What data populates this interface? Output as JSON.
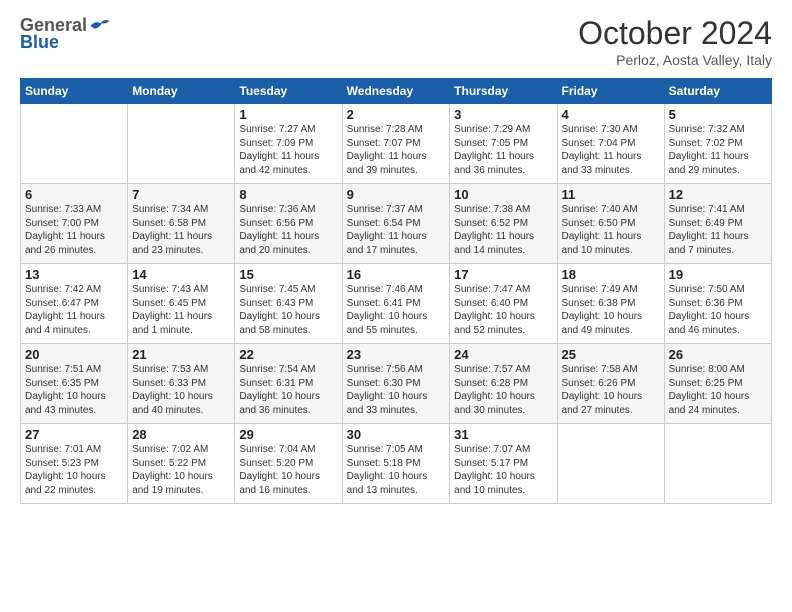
{
  "logo": {
    "general": "General",
    "blue": "Blue"
  },
  "header": {
    "month": "October 2024",
    "location": "Perloz, Aosta Valley, Italy"
  },
  "weekdays": [
    "Sunday",
    "Monday",
    "Tuesday",
    "Wednesday",
    "Thursday",
    "Friday",
    "Saturday"
  ],
  "weeks": [
    [
      {
        "day": "",
        "info": ""
      },
      {
        "day": "",
        "info": ""
      },
      {
        "day": "1",
        "info": "Sunrise: 7:27 AM\nSunset: 7:09 PM\nDaylight: 11 hours\nand 42 minutes."
      },
      {
        "day": "2",
        "info": "Sunrise: 7:28 AM\nSunset: 7:07 PM\nDaylight: 11 hours\nand 39 minutes."
      },
      {
        "day": "3",
        "info": "Sunrise: 7:29 AM\nSunset: 7:05 PM\nDaylight: 11 hours\nand 36 minutes."
      },
      {
        "day": "4",
        "info": "Sunrise: 7:30 AM\nSunset: 7:04 PM\nDaylight: 11 hours\nand 33 minutes."
      },
      {
        "day": "5",
        "info": "Sunrise: 7:32 AM\nSunset: 7:02 PM\nDaylight: 11 hours\nand 29 minutes."
      }
    ],
    [
      {
        "day": "6",
        "info": "Sunrise: 7:33 AM\nSunset: 7:00 PM\nDaylight: 11 hours\nand 26 minutes."
      },
      {
        "day": "7",
        "info": "Sunrise: 7:34 AM\nSunset: 6:58 PM\nDaylight: 11 hours\nand 23 minutes."
      },
      {
        "day": "8",
        "info": "Sunrise: 7:36 AM\nSunset: 6:56 PM\nDaylight: 11 hours\nand 20 minutes."
      },
      {
        "day": "9",
        "info": "Sunrise: 7:37 AM\nSunset: 6:54 PM\nDaylight: 11 hours\nand 17 minutes."
      },
      {
        "day": "10",
        "info": "Sunrise: 7:38 AM\nSunset: 6:52 PM\nDaylight: 11 hours\nand 14 minutes."
      },
      {
        "day": "11",
        "info": "Sunrise: 7:40 AM\nSunset: 6:50 PM\nDaylight: 11 hours\nand 10 minutes."
      },
      {
        "day": "12",
        "info": "Sunrise: 7:41 AM\nSunset: 6:49 PM\nDaylight: 11 hours\nand 7 minutes."
      }
    ],
    [
      {
        "day": "13",
        "info": "Sunrise: 7:42 AM\nSunset: 6:47 PM\nDaylight: 11 hours\nand 4 minutes."
      },
      {
        "day": "14",
        "info": "Sunrise: 7:43 AM\nSunset: 6:45 PM\nDaylight: 11 hours\nand 1 minute."
      },
      {
        "day": "15",
        "info": "Sunrise: 7:45 AM\nSunset: 6:43 PM\nDaylight: 10 hours\nand 58 minutes."
      },
      {
        "day": "16",
        "info": "Sunrise: 7:46 AM\nSunset: 6:41 PM\nDaylight: 10 hours\nand 55 minutes."
      },
      {
        "day": "17",
        "info": "Sunrise: 7:47 AM\nSunset: 6:40 PM\nDaylight: 10 hours\nand 52 minutes."
      },
      {
        "day": "18",
        "info": "Sunrise: 7:49 AM\nSunset: 6:38 PM\nDaylight: 10 hours\nand 49 minutes."
      },
      {
        "day": "19",
        "info": "Sunrise: 7:50 AM\nSunset: 6:36 PM\nDaylight: 10 hours\nand 46 minutes."
      }
    ],
    [
      {
        "day": "20",
        "info": "Sunrise: 7:51 AM\nSunset: 6:35 PM\nDaylight: 10 hours\nand 43 minutes."
      },
      {
        "day": "21",
        "info": "Sunrise: 7:53 AM\nSunset: 6:33 PM\nDaylight: 10 hours\nand 40 minutes."
      },
      {
        "day": "22",
        "info": "Sunrise: 7:54 AM\nSunset: 6:31 PM\nDaylight: 10 hours\nand 36 minutes."
      },
      {
        "day": "23",
        "info": "Sunrise: 7:56 AM\nSunset: 6:30 PM\nDaylight: 10 hours\nand 33 minutes."
      },
      {
        "day": "24",
        "info": "Sunrise: 7:57 AM\nSunset: 6:28 PM\nDaylight: 10 hours\nand 30 minutes."
      },
      {
        "day": "25",
        "info": "Sunrise: 7:58 AM\nSunset: 6:26 PM\nDaylight: 10 hours\nand 27 minutes."
      },
      {
        "day": "26",
        "info": "Sunrise: 8:00 AM\nSunset: 6:25 PM\nDaylight: 10 hours\nand 24 minutes."
      }
    ],
    [
      {
        "day": "27",
        "info": "Sunrise: 7:01 AM\nSunset: 5:23 PM\nDaylight: 10 hours\nand 22 minutes."
      },
      {
        "day": "28",
        "info": "Sunrise: 7:02 AM\nSunset: 5:22 PM\nDaylight: 10 hours\nand 19 minutes."
      },
      {
        "day": "29",
        "info": "Sunrise: 7:04 AM\nSunset: 5:20 PM\nDaylight: 10 hours\nand 16 minutes."
      },
      {
        "day": "30",
        "info": "Sunrise: 7:05 AM\nSunset: 5:18 PM\nDaylight: 10 hours\nand 13 minutes."
      },
      {
        "day": "31",
        "info": "Sunrise: 7:07 AM\nSunset: 5:17 PM\nDaylight: 10 hours\nand 10 minutes."
      },
      {
        "day": "",
        "info": ""
      },
      {
        "day": "",
        "info": ""
      }
    ]
  ]
}
